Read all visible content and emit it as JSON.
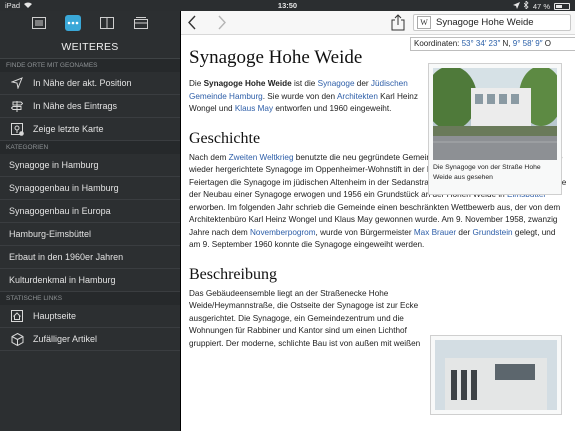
{
  "status": {
    "left": "iPad",
    "time": "13:50",
    "battery_label": "47 %",
    "battery_level": 0.47
  },
  "sidebar": {
    "title": "WEITERES",
    "sections": {
      "geonames": "FINDE ORTE MIT GEONAMES",
      "kategorien": "KATEGORIEN",
      "statische": "STATISCHE LINKS"
    },
    "geo_items": [
      "In Nähe der akt. Position",
      "In Nähe des Eintrags",
      "Zeige letzte Karte"
    ],
    "categories": [
      "Synagoge in Hamburg",
      "Synagogenbau in Hamburg",
      "Synagogenbau in Europa",
      "Hamburg-Eimsbüttel",
      "Erbaut in den 1960er Jahren",
      "Kulturdenkmal in Hamburg"
    ],
    "static_links": [
      "Hauptseite",
      "Zufälliger Artikel"
    ]
  },
  "search": {
    "value": "Synagoge Hohe Weide",
    "wiki_glyph": "W"
  },
  "coords": {
    "label": "Koordinaten:",
    "lat": "53° 34′ 23″",
    "lat_dir": "N,",
    "lon": "9° 58′ 9″",
    "lon_dir": "O"
  },
  "article": {
    "title": "Synagoge Hohe Weide",
    "lead": {
      "t1": "Die ",
      "b1": "Synagoge Hohe Weide",
      "t2": " ist die ",
      "l1": "Synagoge",
      "t3": " der ",
      "l2": "Jüdischen Gemeinde Hamburg",
      "t4": ". Sie wurde von den ",
      "l3": "Architekten",
      "t5": " Karl Heinz Wongel und ",
      "l4": "Klaus May",
      "t6": " entworfen und 1960 eingeweiht."
    },
    "infobox_caption": "Die Synagoge von der Straße Hohe Weide aus gesehen",
    "h_geschichte": "Geschichte",
    "geschichte": {
      "t1": "Nach dem ",
      "l1": "Zweiten Weltkrieg",
      "t2": " benutzte die neu gegründete Gemeinde ab September 1945 zunächst die wieder hergerichtete Synagoge im Oppenheimer-Wohnstift in der Kielortallee sowie an hohen Feiertagen die Synagoge im jüdischen Altenheim in der Sedanstraße. Seit Mitte der 1950er Jahre wurde der Neubau einer Synagoge erwogen und 1956 ein Grundstück an der Hohen Weide in ",
      "l2": "Eimsbüttel",
      "t3": " erworben. Im folgenden Jahr schrieb die Gemeinde einen beschränkten Wettbewerb aus, der von dem Architektenbüro Karl Heinz Wongel und Klaus May gewonnen wurde. Am 9. November 1958, zwanzig Jahre nach dem ",
      "l3": "Novemberpogrom",
      "t4": ", wurde von Bürgermeister ",
      "l4": "Max Brauer",
      "t5": " der ",
      "l5": "Grundstein",
      "t6": " gelegt, und am 9. September 1960 konnte die Synagoge eingeweiht werden."
    },
    "h_beschreibung": "Beschreibung",
    "beschreibung": "Das Gebäudeensemble liegt an der Straßenecke Hohe Weide/Heymannstraße, die Ostseite der Synagoge ist zur Ecke ausgerichtet. Die Synagoge, ein Gemeindezentrum und die Wohnungen für Rabbiner und Kantor sind um einen Lichthof gruppiert. Der moderne, schlichte Bau ist von außen mit weißen"
  }
}
